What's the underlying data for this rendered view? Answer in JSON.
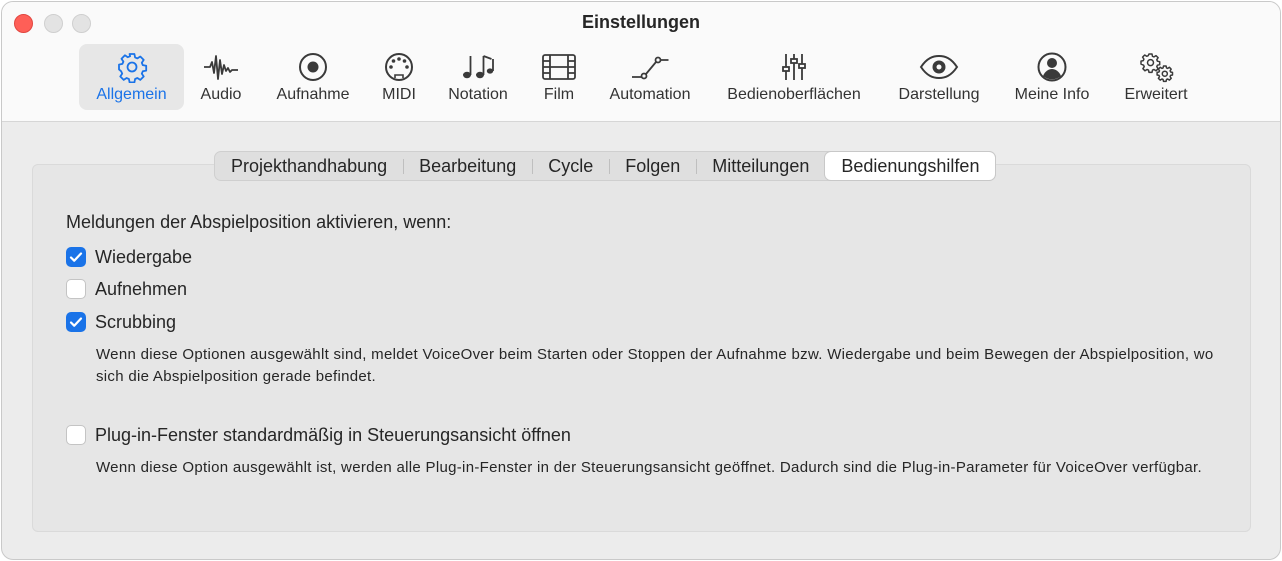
{
  "window": {
    "title": "Einstellungen"
  },
  "toolbar": {
    "items": [
      {
        "label": "Allgemein",
        "icon": "gear-icon",
        "active": true
      },
      {
        "label": "Audio",
        "icon": "waveform-icon"
      },
      {
        "label": "Aufnahme",
        "icon": "record-icon"
      },
      {
        "label": "MIDI",
        "icon": "midi-connector-icon"
      },
      {
        "label": "Notation",
        "icon": "music-notes-icon"
      },
      {
        "label": "Film",
        "icon": "film-strip-icon"
      },
      {
        "label": "Automation",
        "icon": "automation-curve-icon"
      },
      {
        "label": "Bedienoberflächen",
        "icon": "faders-icon"
      },
      {
        "label": "Darstellung",
        "icon": "eye-icon"
      },
      {
        "label": "Meine Info",
        "icon": "person-icon"
      },
      {
        "label": "Erweitert",
        "icon": "gears-icon"
      }
    ],
    "accent_color": "#1a73e8"
  },
  "tabs": [
    {
      "label": "Projekthandhabung"
    },
    {
      "label": "Bearbeitung"
    },
    {
      "label": "Cycle"
    },
    {
      "label": "Folgen"
    },
    {
      "label": "Mitteilungen"
    },
    {
      "label": "Bedienungshilfen",
      "active": true
    }
  ],
  "content": {
    "heading": "Meldungen der Abspielposition aktivieren, wenn:",
    "options": [
      {
        "label": "Wiedergabe",
        "checked": true
      },
      {
        "label": "Aufnehmen",
        "checked": false
      },
      {
        "label": "Scrubbing",
        "checked": true
      }
    ],
    "description1": "Wenn diese Optionen ausgewählt sind, meldet VoiceOver beim Starten oder Stoppen der Aufnahme bzw. Wiedergabe und beim Bewegen der Abspielposition, wo sich die Abspielposition gerade befindet.",
    "plugin_option": {
      "label": "Plug-in-Fenster standardmäßig in Steuerungsansicht öffnen",
      "checked": false
    },
    "description2": "Wenn diese Option ausgewählt ist, werden alle Plug-in-Fenster in der Steuerungsansicht geöffnet. Dadurch sind die Plug-in-Parameter für VoiceOver verfügbar."
  }
}
